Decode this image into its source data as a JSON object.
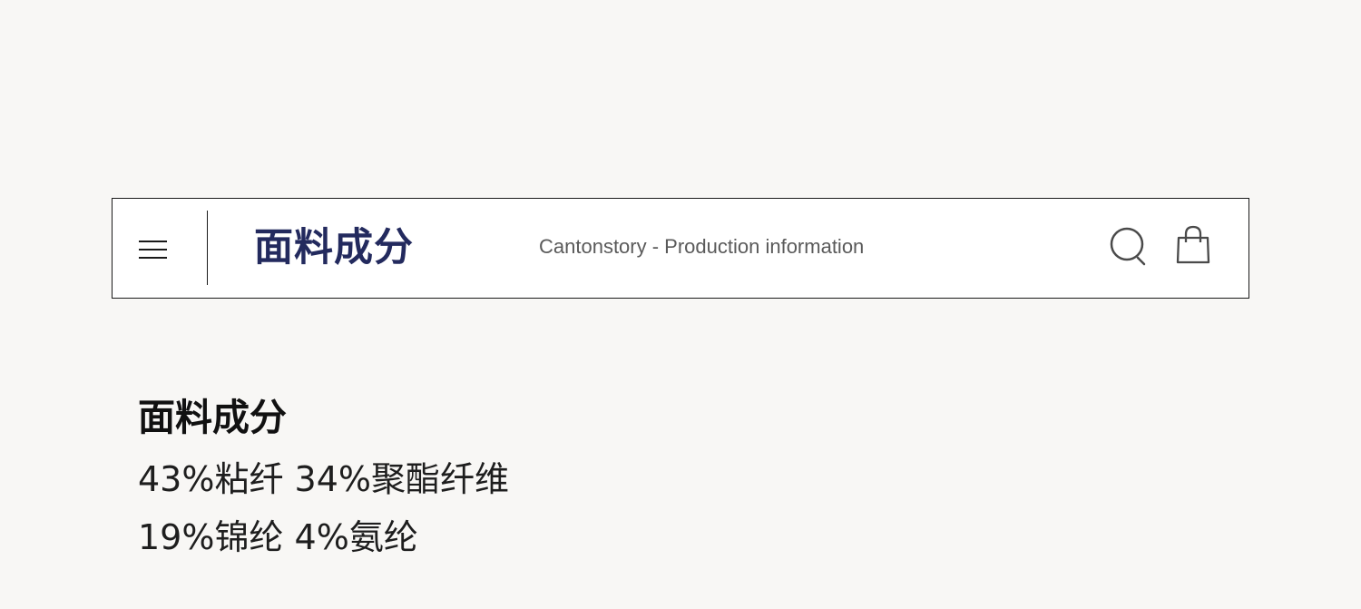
{
  "header": {
    "title": "面料成分",
    "subtitle": "Cantonstory - Production information",
    "icons": {
      "menu": "hamburger-menu-icon",
      "search": "search-icon",
      "cart": "shopping-bag-icon"
    },
    "colors": {
      "title": "#232a5e",
      "subtitle": "#5a5a5a",
      "border": "#1a1a1a"
    }
  },
  "content": {
    "heading": "面料成分",
    "composition_lines": [
      "43%粘纤 34%聚酯纤维",
      "19%锦纶 4%氨纶"
    ]
  },
  "page": {
    "background": "#f8f7f5"
  }
}
